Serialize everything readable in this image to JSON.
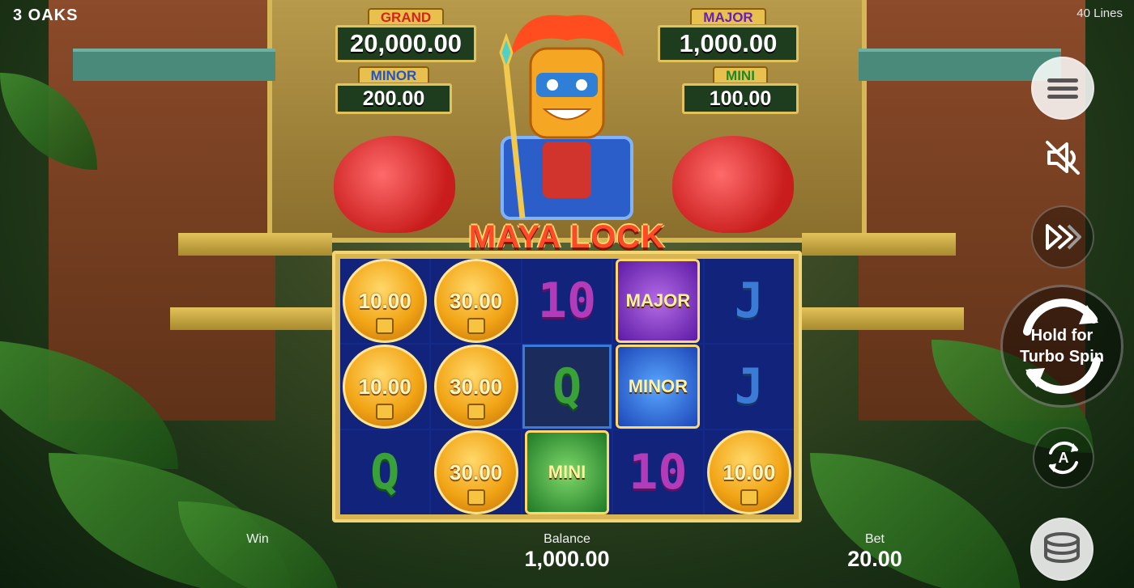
{
  "header": {
    "brand": "3 OAKS",
    "lines": "40 Lines"
  },
  "jackpots": {
    "grand": {
      "label": "GRAND",
      "value": "20,000.00"
    },
    "major": {
      "label": "MAJOR",
      "value": "1,000.00"
    },
    "minor": {
      "label": "MINOR",
      "value": "200.00"
    },
    "mini": {
      "label": "MINI",
      "value": "100.00"
    }
  },
  "logo": "MAYA LOCK",
  "reels": {
    "r1c1": "10.00",
    "r1c2": "30.00",
    "r1c3": "10",
    "r1c4": "MAJOR",
    "r1c5": "J",
    "r2c1": "10.00",
    "r2c2": "30.00",
    "r2c3": "Q",
    "r2c4": "MINOR",
    "r2c5": "J",
    "r3c1": "Q",
    "r3c2": "30.00",
    "r3c3": "MINI",
    "r3c4": "10",
    "r3c5": "10.00"
  },
  "controls": {
    "spin_line1": "Hold for",
    "spin_line2": "Turbo Spin",
    "auto_label": "A",
    "icons": [
      "menu-icon",
      "sound-muted-icon",
      "turbo-icon",
      "spin-icon",
      "autoplay-icon",
      "coins-stack-icon"
    ]
  },
  "footer": {
    "win_label": "Win",
    "balance_label": "Balance",
    "balance_value": "1,000.00",
    "bet_label": "Bet",
    "bet_value": "20.00"
  },
  "colors": {
    "board_gold": "#d9b552",
    "reel_blue": "#11237a",
    "coin_gold": "#f2a516"
  }
}
